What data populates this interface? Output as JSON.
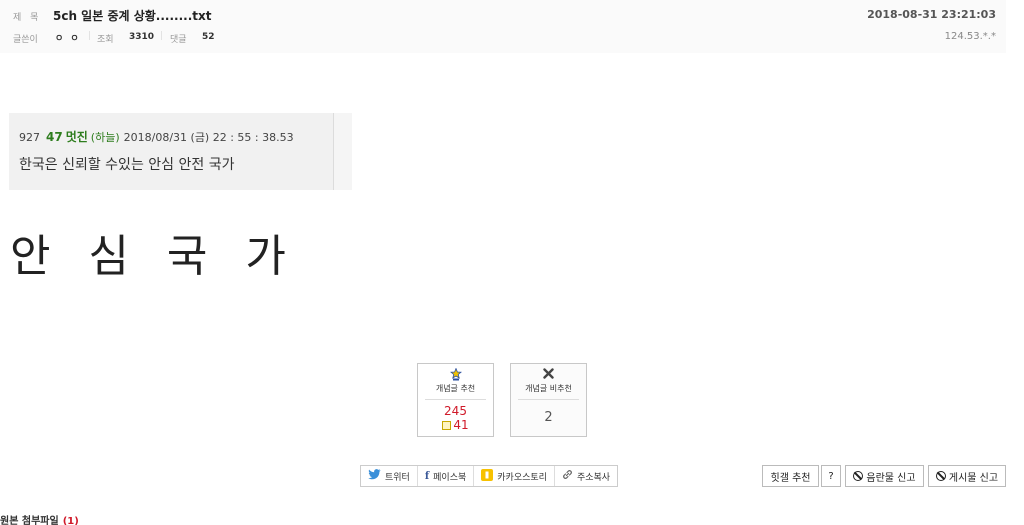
{
  "header": {
    "title_label": "제 목",
    "title": "5ch 일본 중계 상황........txt",
    "date": "2018-08-31 23:21:03",
    "writer_label": "글쓴이",
    "writer": "ㅇ ㅇ",
    "views_label": "조회",
    "views": "3310",
    "comments_label": "댓글",
    "comments": "52",
    "ip": "124.53.*.*",
    "separator": "|"
  },
  "quote": {
    "number": "927",
    "number2": "47",
    "nickname": "멋진",
    "nickname_sub": "(하늘)",
    "datetime": "2018/08/31 (금) 22 : 55 : 38.53",
    "text": "한국은 신뢰할 수있는 안심 안전 국가"
  },
  "body": {
    "big_text": "안 심 국 가"
  },
  "votes": {
    "up_label": "개념글 추천",
    "up_count": "245",
    "up_sub_count": "41",
    "down_label": "개념글 비추천",
    "down_count": "2",
    "up_icon": "star-badge-icon",
    "down_icon": "x-mark-icon",
    "count_color": "#d01a2a"
  },
  "share": {
    "twitter": "트위터",
    "facebook": "페이스북",
    "kakaostory": "카카오스토리",
    "copy_url": "주소복사"
  },
  "actions": {
    "hit_recommend": "힛갤 추천",
    "help": "?",
    "report_obscene": "음란물 신고",
    "report_post": "게시물 신고"
  },
  "attachments": {
    "label": "원본 첨부파일",
    "count": "(1)"
  }
}
